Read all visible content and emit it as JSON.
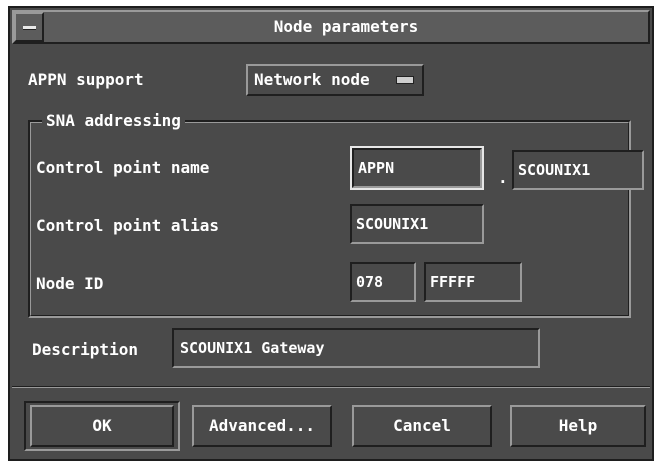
{
  "window": {
    "title": "Node parameters"
  },
  "appn": {
    "label": "APPN support",
    "selected": "Network node"
  },
  "sna": {
    "group_title": "SNA addressing",
    "cp_name_label": "Control point name",
    "cp_name_network": "APPN",
    "cp_name_separator": ".",
    "cp_name_value": "SCOUNIX1",
    "cp_alias_label": "Control point alias",
    "cp_alias_value": "SCOUNIX1",
    "node_id_label": "Node ID",
    "node_id_block": "078",
    "node_id_num": "FFFFF"
  },
  "description": {
    "label": "Description",
    "value": "SCOUNIX1 Gateway"
  },
  "buttons": {
    "ok": "OK",
    "advanced": "Advanced...",
    "cancel": "Cancel",
    "help": "Help"
  },
  "colors": {
    "background": "#4a4a4a",
    "titlebar": "#5c5c5c",
    "text": "#ffffff"
  }
}
